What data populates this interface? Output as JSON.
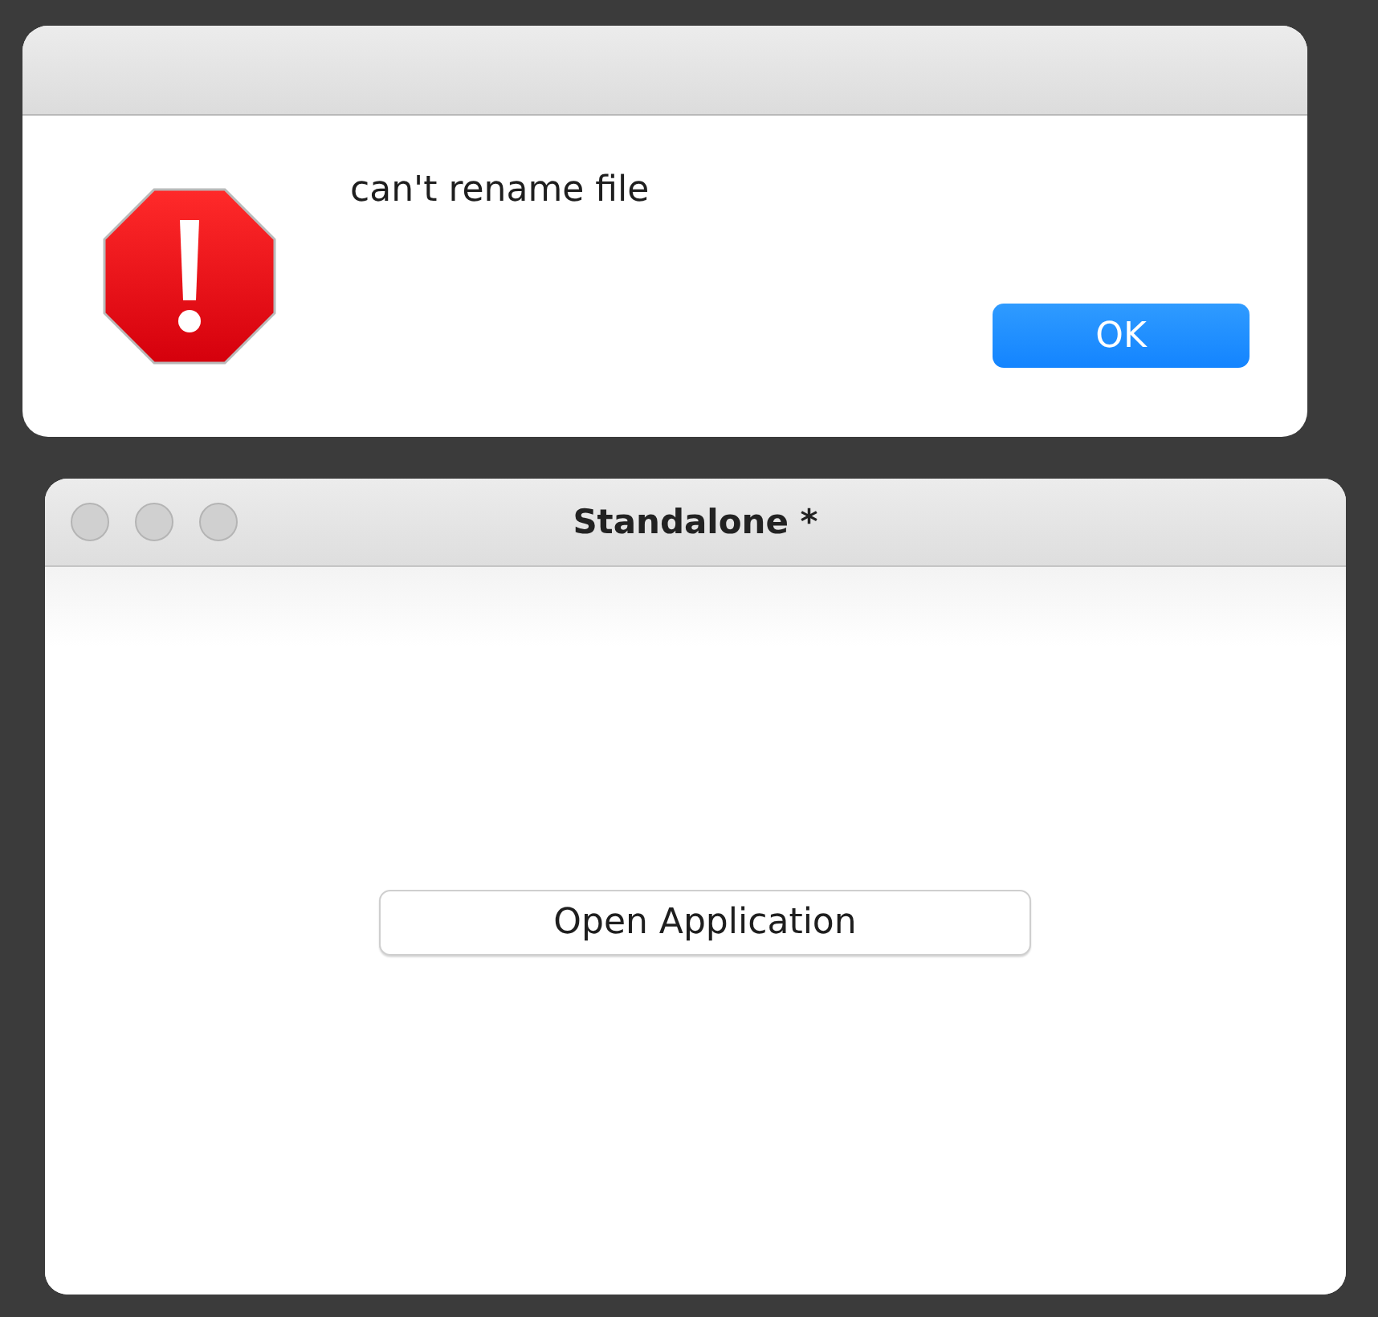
{
  "alert": {
    "message": "can't rename file",
    "buttons": [
      {
        "label": "OK",
        "default": true
      }
    ]
  },
  "window": {
    "title": "Standalone *",
    "buttons": [
      {
        "label": "Open Application",
        "default": false
      }
    ]
  }
}
